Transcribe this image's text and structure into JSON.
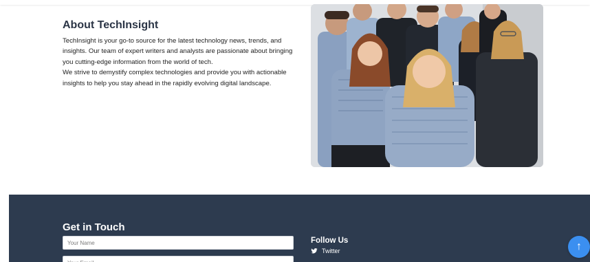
{
  "about": {
    "title": "About TechInsight",
    "paragraph1": "TechInsight is your go-to source for the latest technology news, trends, and insights. Our team of expert writers and analysts are passionate about bringing you cutting-edge information from the world of tech.",
    "paragraph2": "We strive to demystify complex technologies and provide you with actionable insights to help you stay ahead in the rapidly evolving digital landscape."
  },
  "footer": {
    "contact_title": "Get in Touch",
    "name_placeholder": "Your Name",
    "email_placeholder": "Your Email",
    "follow_title": "Follow Us",
    "social": [
      {
        "label": "Twitter",
        "icon": "twitter-icon"
      }
    ]
  },
  "scroll_top": {
    "icon": "arrow-up-icon",
    "glyph": "↑"
  },
  "colors": {
    "footer_bg": "#2d3b4f",
    "accent": "#3b8ff0",
    "heading": "#2b3546"
  }
}
